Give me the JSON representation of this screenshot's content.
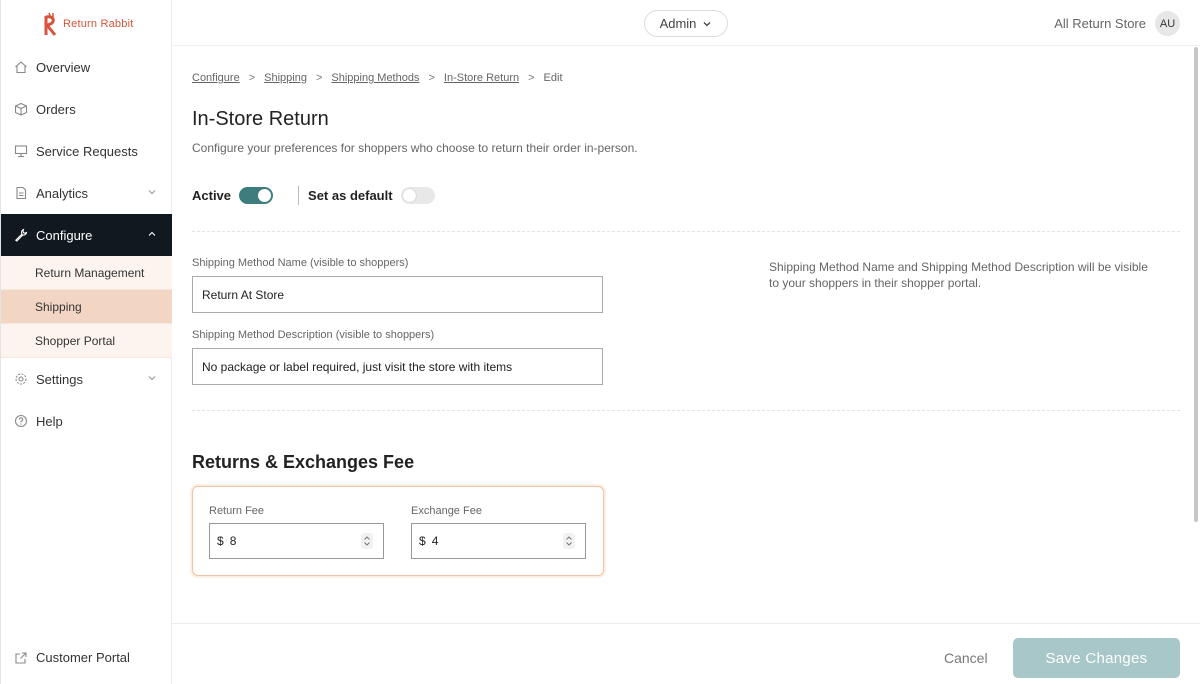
{
  "brand": {
    "name": "Return Rabbit",
    "color": "#d9533c"
  },
  "sidebar": {
    "items": [
      {
        "label": "Overview",
        "icon": "home-icon"
      },
      {
        "label": "Orders",
        "icon": "box-icon"
      },
      {
        "label": "Service Requests",
        "icon": "monitor-icon"
      },
      {
        "label": "Analytics",
        "icon": "document-icon"
      },
      {
        "label": "Configure",
        "icon": "wrench-icon"
      }
    ],
    "configure_sub": [
      {
        "label": "Return Management"
      },
      {
        "label": "Shipping"
      },
      {
        "label": "Shopper Portal"
      }
    ],
    "settings": {
      "label": "Settings"
    },
    "help": {
      "label": "Help"
    },
    "customer_portal": {
      "label": "Customer Portal"
    }
  },
  "topbar": {
    "role": "Admin",
    "store": "All Return Store",
    "avatar": "AU"
  },
  "breadcrumb": [
    "Configure",
    "Shipping",
    "Shipping Methods",
    "In-Store Return",
    "Edit"
  ],
  "page": {
    "title": "In-Store Return",
    "subtitle": "Configure your preferences for shoppers who choose to return their order in-person."
  },
  "toggles": {
    "active_label": "Active",
    "active_on": true,
    "default_label": "Set as default",
    "default_on": false
  },
  "form": {
    "name_label": "Shipping Method Name (visible to shoppers)",
    "name_value": "Return At Store",
    "desc_label": "Shipping Method Description (visible to shoppers)",
    "desc_value": "No package or label required, just visit the store with items",
    "help_note": "Shipping Method Name and Shipping Method Description will be visible to your shoppers in their shopper portal."
  },
  "fees": {
    "title": "Returns & Exchanges Fee",
    "return_label": "Return Fee",
    "return_currency": "$",
    "return_value": "8",
    "exchange_label": "Exchange Fee",
    "exchange_currency": "$",
    "exchange_value": "4"
  },
  "footer": {
    "cancel_label": "Cancel",
    "save_label": "Save Changes"
  },
  "colors": {
    "accent": "#3e7d7d",
    "nav_active_bg": "#101820",
    "submenu_selected": "#f2d5c3",
    "save_button": "#a8c7c8"
  }
}
